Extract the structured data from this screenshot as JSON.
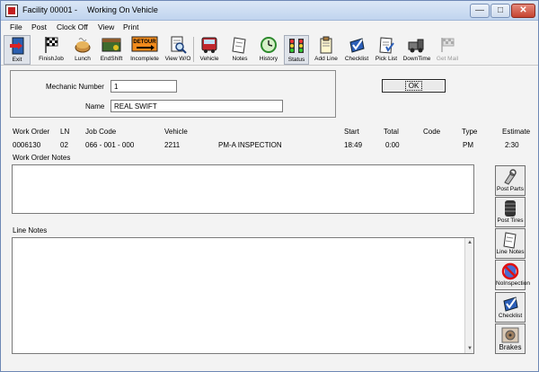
{
  "window": {
    "title_facility": "Facility 00001 -",
    "title_context": "Working On Vehicle",
    "min_glyph": "—",
    "max_glyph": "□",
    "close_glyph": "✕"
  },
  "menu": [
    "File",
    "Post",
    "Clock Off",
    "View",
    "Print"
  ],
  "toolbar": [
    {
      "label": "Exit",
      "icon": "exit-icon"
    },
    {
      "label": "FinishJob",
      "icon": "finish-flag-icon"
    },
    {
      "label": "Lunch",
      "icon": "lunch-icon"
    },
    {
      "label": "EndShift",
      "icon": "end-shift-icon"
    },
    {
      "label": "Incomplete",
      "icon": "detour-sign-icon",
      "sign_text": "DETOUR"
    },
    {
      "label": "View W/O",
      "icon": "magnifier-document-icon"
    },
    {
      "label": "Vehicle",
      "icon": "bus-icon"
    },
    {
      "label": "Notes",
      "icon": "notepad-icon"
    },
    {
      "label": "History",
      "icon": "history-icon"
    },
    {
      "label": "Status",
      "icon": "traffic-light-icon"
    },
    {
      "label": "Add Line",
      "icon": "add-line-icon"
    },
    {
      "label": "Checklist",
      "icon": "checklist-icon"
    },
    {
      "label": "Pick List",
      "icon": "pick-list-icon"
    },
    {
      "label": "DownTime",
      "icon": "tow-truck-icon"
    },
    {
      "label": "Get Mail",
      "icon": "mail-flag-icon",
      "disabled": true
    }
  ],
  "mechanic": {
    "number_label": "Mechanic Number",
    "number_value": "1",
    "name_label": "Name",
    "name_value": "REAL SWIFT"
  },
  "ok_button": "OK",
  "work_order": {
    "headers": {
      "work_order": "Work Order",
      "ln": "LN",
      "job_code": "Job Code",
      "vehicle": "Vehicle",
      "start": "Start",
      "total": "Total",
      "code": "Code",
      "type": "Type",
      "estimate": "Estimate"
    },
    "row": {
      "work_order": "0006130",
      "ln": "02",
      "job_code": "066 - 001 - 000",
      "vehicle": "2211",
      "description": "PM-A INSPECTION",
      "start": "18:49",
      "total": "0:00",
      "code": "",
      "type": "PM",
      "estimate": "2:30"
    }
  },
  "work_order_notes_label": "Work Order Notes",
  "line_notes_label": "Line Notes",
  "scroll_up_glyph": "▲",
  "scroll_down_glyph": "▼",
  "side_buttons": [
    {
      "label": "Post Parts",
      "icon": "parts-icon"
    },
    {
      "label": "Post Tires",
      "icon": "tire-icon"
    },
    {
      "label": "Line Notes",
      "icon": "notepad-icon"
    },
    {
      "label": "NoInspection",
      "icon": "no-inspection-icon"
    },
    {
      "label": "Checklist",
      "icon": "checklist-icon"
    },
    {
      "label": "Brakes",
      "icon": "brakes-icon"
    }
  ]
}
